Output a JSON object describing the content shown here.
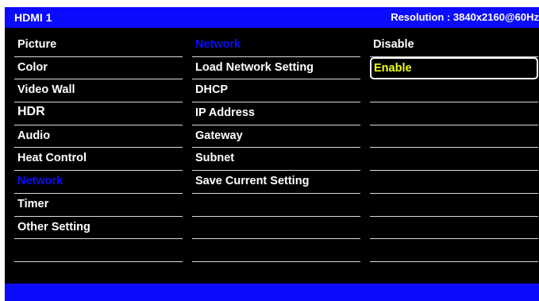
{
  "header": {
    "source": "HDMI 1",
    "resolution": "Resolution : 3840x2160@60Hz"
  },
  "main_menu": {
    "items": [
      {
        "label": "Picture"
      },
      {
        "label": "Color"
      },
      {
        "label": "Video Wall"
      },
      {
        "label": "HDR"
      },
      {
        "label": "Audio"
      },
      {
        "label": "Heat Control"
      },
      {
        "label": "Network",
        "state": "active"
      },
      {
        "label": "Timer"
      },
      {
        "label": "Other Setting"
      }
    ]
  },
  "submenu": {
    "title": "Network",
    "items": [
      {
        "label": "Load Network Setting"
      },
      {
        "label": "DHCP"
      },
      {
        "label": "IP Address"
      },
      {
        "label": "Gateway"
      },
      {
        "label": "Subnet"
      },
      {
        "label": "Save Current Setting"
      }
    ]
  },
  "options": {
    "items": [
      {
        "label": "Disable"
      },
      {
        "label": "Enable",
        "state": "selected"
      }
    ]
  },
  "colors": {
    "accent_blue": "#0b0bff",
    "highlight_yellow": "#f0ff10",
    "background": "#000000",
    "text": "#ffffff"
  }
}
